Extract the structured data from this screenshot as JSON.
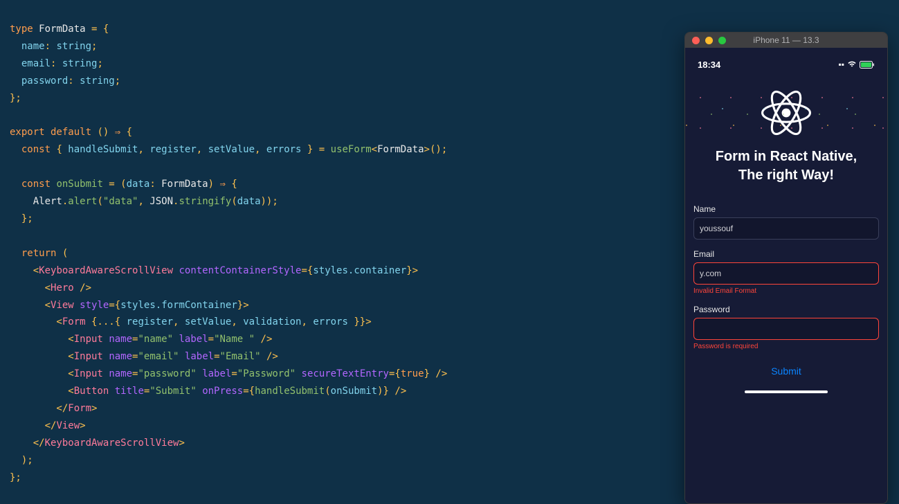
{
  "editor": {
    "code": [
      {
        "tokens": [
          {
            "t": "type ",
            "c": "kw"
          },
          {
            "t": "FormData",
            "c": "type"
          },
          {
            "t": " = ",
            "c": "punc"
          },
          {
            "t": "{",
            "c": "punc"
          }
        ]
      },
      {
        "tokens": [
          {
            "t": "  name",
            "c": "prop"
          },
          {
            "t": ": ",
            "c": "punc"
          },
          {
            "t": "string",
            "c": "var"
          },
          {
            "t": ";",
            "c": "punc"
          }
        ]
      },
      {
        "tokens": [
          {
            "t": "  email",
            "c": "prop"
          },
          {
            "t": ": ",
            "c": "punc"
          },
          {
            "t": "string",
            "c": "var"
          },
          {
            "t": ";",
            "c": "punc"
          }
        ]
      },
      {
        "tokens": [
          {
            "t": "  password",
            "c": "prop"
          },
          {
            "t": ": ",
            "c": "punc"
          },
          {
            "t": "string",
            "c": "var"
          },
          {
            "t": ";",
            "c": "punc"
          }
        ]
      },
      {
        "tokens": [
          {
            "t": "};",
            "c": "punc"
          }
        ]
      },
      {
        "tokens": [
          {
            "t": " ",
            "c": ""
          }
        ]
      },
      {
        "tokens": [
          {
            "t": "export default ",
            "c": "kw"
          },
          {
            "t": "() ",
            "c": "punc"
          },
          {
            "t": "⇒",
            "c": "kw"
          },
          {
            "t": " {",
            "c": "punc"
          }
        ]
      },
      {
        "tokens": [
          {
            "t": "  const ",
            "c": "kw"
          },
          {
            "t": "{ ",
            "c": "punc"
          },
          {
            "t": "handleSubmit",
            "c": "var"
          },
          {
            "t": ", ",
            "c": "punc"
          },
          {
            "t": "register",
            "c": "var"
          },
          {
            "t": ", ",
            "c": "punc"
          },
          {
            "t": "setValue",
            "c": "var"
          },
          {
            "t": ", ",
            "c": "punc"
          },
          {
            "t": "errors",
            "c": "var"
          },
          {
            "t": " } = ",
            "c": "punc"
          },
          {
            "t": "useForm",
            "c": "fn"
          },
          {
            "t": "<",
            "c": "punc"
          },
          {
            "t": "FormData",
            "c": "type"
          },
          {
            "t": ">();",
            "c": "punc"
          }
        ]
      },
      {
        "tokens": [
          {
            "t": " ",
            "c": ""
          }
        ]
      },
      {
        "tokens": [
          {
            "t": "  const ",
            "c": "kw"
          },
          {
            "t": "onSubmit",
            "c": "fn"
          },
          {
            "t": " = (",
            "c": "punc"
          },
          {
            "t": "data",
            "c": "var"
          },
          {
            "t": ": ",
            "c": "punc"
          },
          {
            "t": "FormData",
            "c": "type"
          },
          {
            "t": ") ",
            "c": "punc"
          },
          {
            "t": "⇒",
            "c": "kw"
          },
          {
            "t": " {",
            "c": "punc"
          }
        ]
      },
      {
        "tokens": [
          {
            "t": "    Alert",
            "c": "type"
          },
          {
            "t": ".",
            "c": "punc"
          },
          {
            "t": "alert",
            "c": "fn"
          },
          {
            "t": "(",
            "c": "punc"
          },
          {
            "t": "\"data\"",
            "c": "str"
          },
          {
            "t": ", ",
            "c": "punc"
          },
          {
            "t": "JSON",
            "c": "type"
          },
          {
            "t": ".",
            "c": "punc"
          },
          {
            "t": "stringify",
            "c": "fn"
          },
          {
            "t": "(",
            "c": "punc"
          },
          {
            "t": "data",
            "c": "var"
          },
          {
            "t": "));",
            "c": "punc"
          }
        ]
      },
      {
        "tokens": [
          {
            "t": "  };",
            "c": "punc"
          }
        ]
      },
      {
        "tokens": [
          {
            "t": " ",
            "c": ""
          }
        ]
      },
      {
        "tokens": [
          {
            "t": "  return ",
            "c": "kw"
          },
          {
            "t": "(",
            "c": "punc"
          }
        ]
      },
      {
        "tokens": [
          {
            "t": "    <",
            "c": "punc"
          },
          {
            "t": "KeyboardAwareScrollView",
            "c": "tag"
          },
          {
            "t": " ",
            "c": ""
          },
          {
            "t": "contentContainerStyle",
            "c": "attr"
          },
          {
            "t": "={",
            "c": "punc"
          },
          {
            "t": "styles.container",
            "c": "var"
          },
          {
            "t": "}>",
            "c": "punc"
          }
        ]
      },
      {
        "tokens": [
          {
            "t": "      <",
            "c": "punc"
          },
          {
            "t": "Hero",
            "c": "tag"
          },
          {
            "t": " />",
            "c": "punc"
          }
        ]
      },
      {
        "tokens": [
          {
            "t": "      <",
            "c": "punc"
          },
          {
            "t": "View",
            "c": "tag"
          },
          {
            "t": " ",
            "c": ""
          },
          {
            "t": "style",
            "c": "attr"
          },
          {
            "t": "={",
            "c": "punc"
          },
          {
            "t": "styles.formContainer",
            "c": "var"
          },
          {
            "t": "}>",
            "c": "punc"
          }
        ]
      },
      {
        "tokens": [
          {
            "t": "        <",
            "c": "punc"
          },
          {
            "t": "Form",
            "c": "tag"
          },
          {
            "t": " {...{ ",
            "c": "punc"
          },
          {
            "t": "register",
            "c": "var"
          },
          {
            "t": ", ",
            "c": "punc"
          },
          {
            "t": "setValue",
            "c": "var"
          },
          {
            "t": ", ",
            "c": "punc"
          },
          {
            "t": "validation",
            "c": "var"
          },
          {
            "t": ", ",
            "c": "punc"
          },
          {
            "t": "errors",
            "c": "var"
          },
          {
            "t": " }}>",
            "c": "punc"
          }
        ]
      },
      {
        "tokens": [
          {
            "t": "          <",
            "c": "punc"
          },
          {
            "t": "Input",
            "c": "tag"
          },
          {
            "t": " ",
            "c": ""
          },
          {
            "t": "name",
            "c": "attr"
          },
          {
            "t": "=",
            "c": "punc"
          },
          {
            "t": "\"name\"",
            "c": "str"
          },
          {
            "t": " ",
            "c": ""
          },
          {
            "t": "label",
            "c": "attr"
          },
          {
            "t": "=",
            "c": "punc"
          },
          {
            "t": "\"Name \"",
            "c": "str"
          },
          {
            "t": " />",
            "c": "punc"
          }
        ]
      },
      {
        "tokens": [
          {
            "t": "          <",
            "c": "punc"
          },
          {
            "t": "Input",
            "c": "tag"
          },
          {
            "t": " ",
            "c": ""
          },
          {
            "t": "name",
            "c": "attr"
          },
          {
            "t": "=",
            "c": "punc"
          },
          {
            "t": "\"email\"",
            "c": "str"
          },
          {
            "t": " ",
            "c": ""
          },
          {
            "t": "label",
            "c": "attr"
          },
          {
            "t": "=",
            "c": "punc"
          },
          {
            "t": "\"Email\"",
            "c": "str"
          },
          {
            "t": " />",
            "c": "punc"
          }
        ]
      },
      {
        "tokens": [
          {
            "t": "          <",
            "c": "punc"
          },
          {
            "t": "Input",
            "c": "tag"
          },
          {
            "t": " ",
            "c": ""
          },
          {
            "t": "name",
            "c": "attr"
          },
          {
            "t": "=",
            "c": "punc"
          },
          {
            "t": "\"password\"",
            "c": "str"
          },
          {
            "t": " ",
            "c": ""
          },
          {
            "t": "label",
            "c": "attr"
          },
          {
            "t": "=",
            "c": "punc"
          },
          {
            "t": "\"Password\"",
            "c": "str"
          },
          {
            "t": " ",
            "c": ""
          },
          {
            "t": "secureTextEntry",
            "c": "attr"
          },
          {
            "t": "={",
            "c": "punc"
          },
          {
            "t": "true",
            "c": "bool"
          },
          {
            "t": "} />",
            "c": "punc"
          }
        ]
      },
      {
        "tokens": [
          {
            "t": "          <",
            "c": "punc"
          },
          {
            "t": "Button",
            "c": "tag"
          },
          {
            "t": " ",
            "c": ""
          },
          {
            "t": "title",
            "c": "attr"
          },
          {
            "t": "=",
            "c": "punc"
          },
          {
            "t": "\"Submit\"",
            "c": "str"
          },
          {
            "t": " ",
            "c": ""
          },
          {
            "t": "onPress",
            "c": "attr"
          },
          {
            "t": "={",
            "c": "punc"
          },
          {
            "t": "handleSubmit",
            "c": "fn"
          },
          {
            "t": "(",
            "c": "punc"
          },
          {
            "t": "onSubmit",
            "c": "var"
          },
          {
            "t": ")} />",
            "c": "punc"
          }
        ]
      },
      {
        "tokens": [
          {
            "t": "        </",
            "c": "punc"
          },
          {
            "t": "Form",
            "c": "tag"
          },
          {
            "t": ">",
            "c": "punc"
          }
        ]
      },
      {
        "tokens": [
          {
            "t": "      </",
            "c": "punc"
          },
          {
            "t": "View",
            "c": "tag"
          },
          {
            "t": ">",
            "c": "punc"
          }
        ]
      },
      {
        "tokens": [
          {
            "t": "    </",
            "c": "punc"
          },
          {
            "t": "KeyboardAwareScrollView",
            "c": "tag"
          },
          {
            "t": ">",
            "c": "punc"
          }
        ]
      },
      {
        "tokens": [
          {
            "t": "  );",
            "c": "punc"
          }
        ]
      },
      {
        "tokens": [
          {
            "t": "};",
            "c": "punc"
          }
        ]
      }
    ]
  },
  "simulator": {
    "title": "iPhone 11 — 13.3"
  },
  "phone": {
    "time": "18:34",
    "hero_title_line1": "Form in React Native,",
    "hero_title_line2": "The right Way!",
    "form": {
      "name": {
        "label": "Name",
        "value": "youssouf",
        "error": ""
      },
      "email": {
        "label": "Email",
        "value": "y.com",
        "error": "Invalid Email Format"
      },
      "password": {
        "label": "Password",
        "value": "",
        "error": "Password is required"
      },
      "submit_label": "Submit"
    }
  }
}
